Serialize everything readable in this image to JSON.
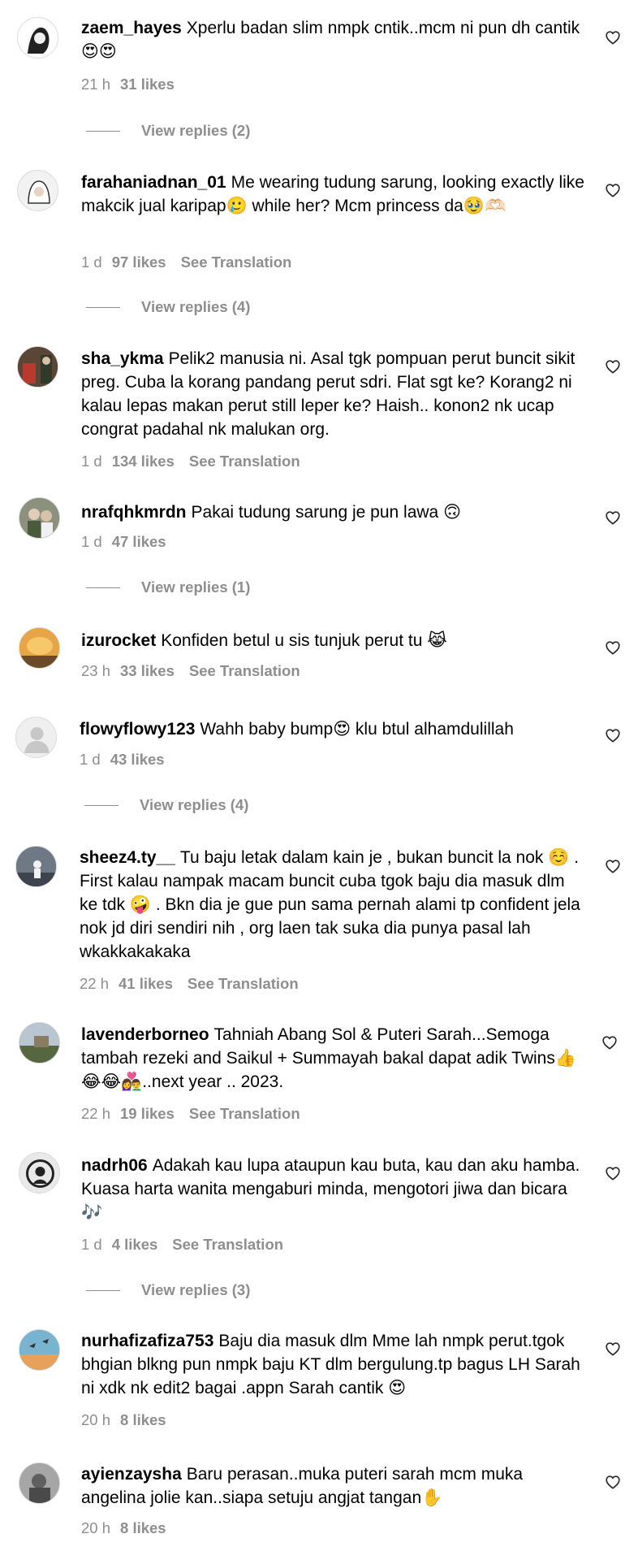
{
  "heart_icon": "heart-outline-icon",
  "colors": {
    "text": "#000000",
    "meta": "#8e8e8e",
    "background": "#ffffff"
  },
  "comments": [
    {
      "username": "zaem_hayes",
      "text": "Xperlu badan slim nmpk cntik..mcm ni pun dh cantik 😍😍",
      "time": "21 h",
      "likes": "31 likes",
      "view_replies": "View replies (2)"
    },
    {
      "username": "farahaniadnan_01",
      "text": "Me wearing tudung sarung, looking exactly like makcik jual karipap🥲 while her? Mcm princess da🥹🫶🏻",
      "time": "1 d",
      "likes": "97 likes",
      "translation": "See Translation",
      "view_replies": "View replies (4)"
    },
    {
      "username": "sha_ykma",
      "text": "Pelik2 manusia ni. Asal tgk pompuan perut buncit sikit preg. Cuba la korang pandang perut sdri. Flat sgt ke? Korang2 ni kalau lepas makan perut still leper ke? Haish.. konon2 nk ucap congrat padahal nk malukan org.",
      "time": "1 d",
      "likes": "134 likes",
      "translation": "See Translation"
    },
    {
      "username": "nrafqhkmrdn",
      "text": "Pakai tudung sarung je pun lawa 🙃",
      "time": "1 d",
      "likes": "47 likes",
      "view_replies": "View replies (1)"
    },
    {
      "username": "izurocket",
      "text": "Konfiden betul u sis tunjuk perut tu 😹",
      "time": "23 h",
      "likes": "33 likes",
      "translation": "See Translation"
    },
    {
      "username": "flowyflowy123",
      "text": "Wahh baby bump😍 klu btul alhamdulillah",
      "time": "1 d",
      "likes": "43 likes",
      "view_replies": "View replies (4)"
    },
    {
      "username": "sheez4.ty__",
      "text": "Tu baju letak dalam kain je , bukan buncit la nok ☺️ . First kalau nampak macam buncit cuba tgok baju dia masuk dlm ke tdk 🤪 . Bkn dia je gue pun sama pernah alami tp confident jela nok jd diri sendiri nih , org laen tak suka dia punya pasal lah wkakkakakaka",
      "time": "22 h",
      "likes": "41 likes",
      "translation": "See Translation"
    },
    {
      "username": "lavenderborneo",
      "text": "Tahniah Abang Sol & Puteri Sarah...Semoga tambah rezeki and Saikul + Summayah bakal dapat adik Twins👍😂😂👩‍❤️‍👨..next year .. 2023.",
      "time": "22 h",
      "likes": "19 likes",
      "translation": "See Translation"
    },
    {
      "username": "nadrh06",
      "text": "Adakah kau lupa ataupun kau buta, kau dan aku hamba. Kuasa harta wanita mengaburi minda, mengotori jiwa dan bicara 🎶",
      "time": "1 d",
      "likes": "4 likes",
      "translation": "See Translation",
      "view_replies": "View replies (3)"
    },
    {
      "username": "nurhafizafiza753",
      "text": "Baju dia masuk dlm Mme lah nmpk perut.tgok bhgian blkng pun nmpk baju KT dlm bergulung.tp bagus LH Sarah ni xdk nk edit2 bagai .appn Sarah cantik 😍",
      "time": "20 h",
      "likes": "8 likes"
    },
    {
      "username": "ayienzaysha",
      "text": "Baru perasan..muka puteri sarah mcm muka angelina jolie kan..siapa setuju angjat tangan✋",
      "time": "20 h",
      "likes": "8 likes"
    }
  ]
}
